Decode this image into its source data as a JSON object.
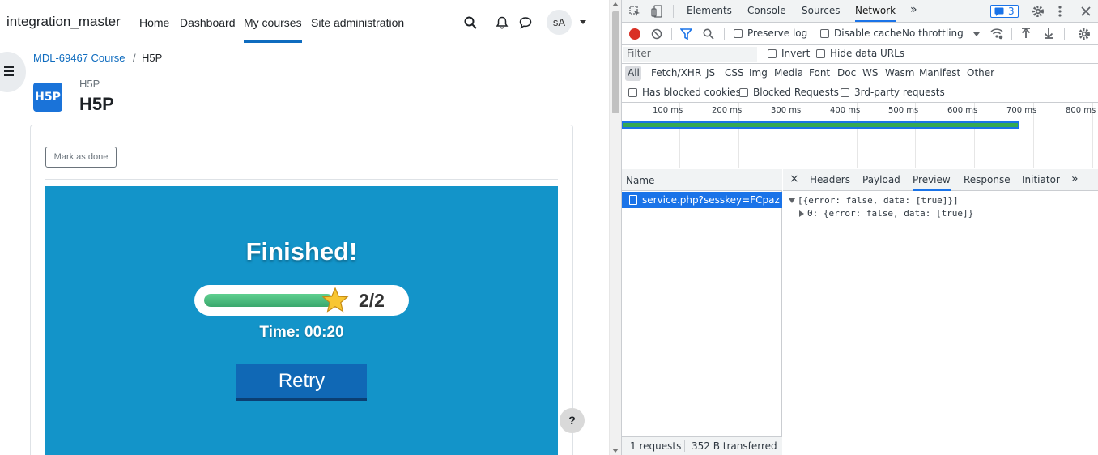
{
  "navbar": {
    "brand": "integration_master",
    "links": [
      "Home",
      "Dashboard",
      "My courses",
      "Site administration"
    ],
    "avatar": "sA"
  },
  "breadcrumb": {
    "course": "MDL-69467 Course",
    "separator": "/",
    "current": "H5P"
  },
  "module": {
    "logo_text": "H5P",
    "type_label": "H5P",
    "title": "H5P",
    "mark_done": "Mark as done"
  },
  "h5p": {
    "finished": "Finished!",
    "score": "2/2",
    "score_fraction": 1.0,
    "time": "Time: 00:20",
    "retry": "Retry",
    "help": "?"
  },
  "devtools": {
    "tabs": [
      "Elements",
      "Console",
      "Sources",
      "Network"
    ],
    "more_tabs": "»",
    "issues_count": "3",
    "toolbar": {
      "preserve_log": "Preserve log",
      "disable_cache": "Disable cache",
      "throttling": "No throttling"
    },
    "filter": {
      "placeholder": "Filter",
      "invert": "Invert",
      "hide_data_urls": "Hide data URLs"
    },
    "types": [
      "All",
      "Fetch/XHR",
      "JS",
      "CSS",
      "Img",
      "Media",
      "Font",
      "Doc",
      "WS",
      "Wasm",
      "Manifest",
      "Other"
    ],
    "checks": [
      "Has blocked cookies",
      "Blocked Requests",
      "3rd-party requests"
    ],
    "timeline_ticks": [
      "100 ms",
      "200 ms",
      "300 ms",
      "400 ms",
      "500 ms",
      "600 ms",
      "700 ms",
      "800 ms"
    ],
    "list_header": "Name",
    "request_name": "service.php?sesskey=FCpazG...",
    "footer_requests": "1 requests",
    "footer_transferred": "352 B transferred",
    "detail_close": "×",
    "detail_tabs": [
      "Headers",
      "Payload",
      "Preview",
      "Response",
      "Initiator"
    ],
    "detail_more": "»",
    "preview_line1": "[{error: false, data: [true]}]",
    "preview_line2": "0: {error: false, data: [true]}"
  },
  "colors": {
    "moodle_blue": "#0f6cbf",
    "h5p_bg": "#1394c9",
    "retry_bg": "#1068b5",
    "devtools_accent": "#1a73e8"
  }
}
